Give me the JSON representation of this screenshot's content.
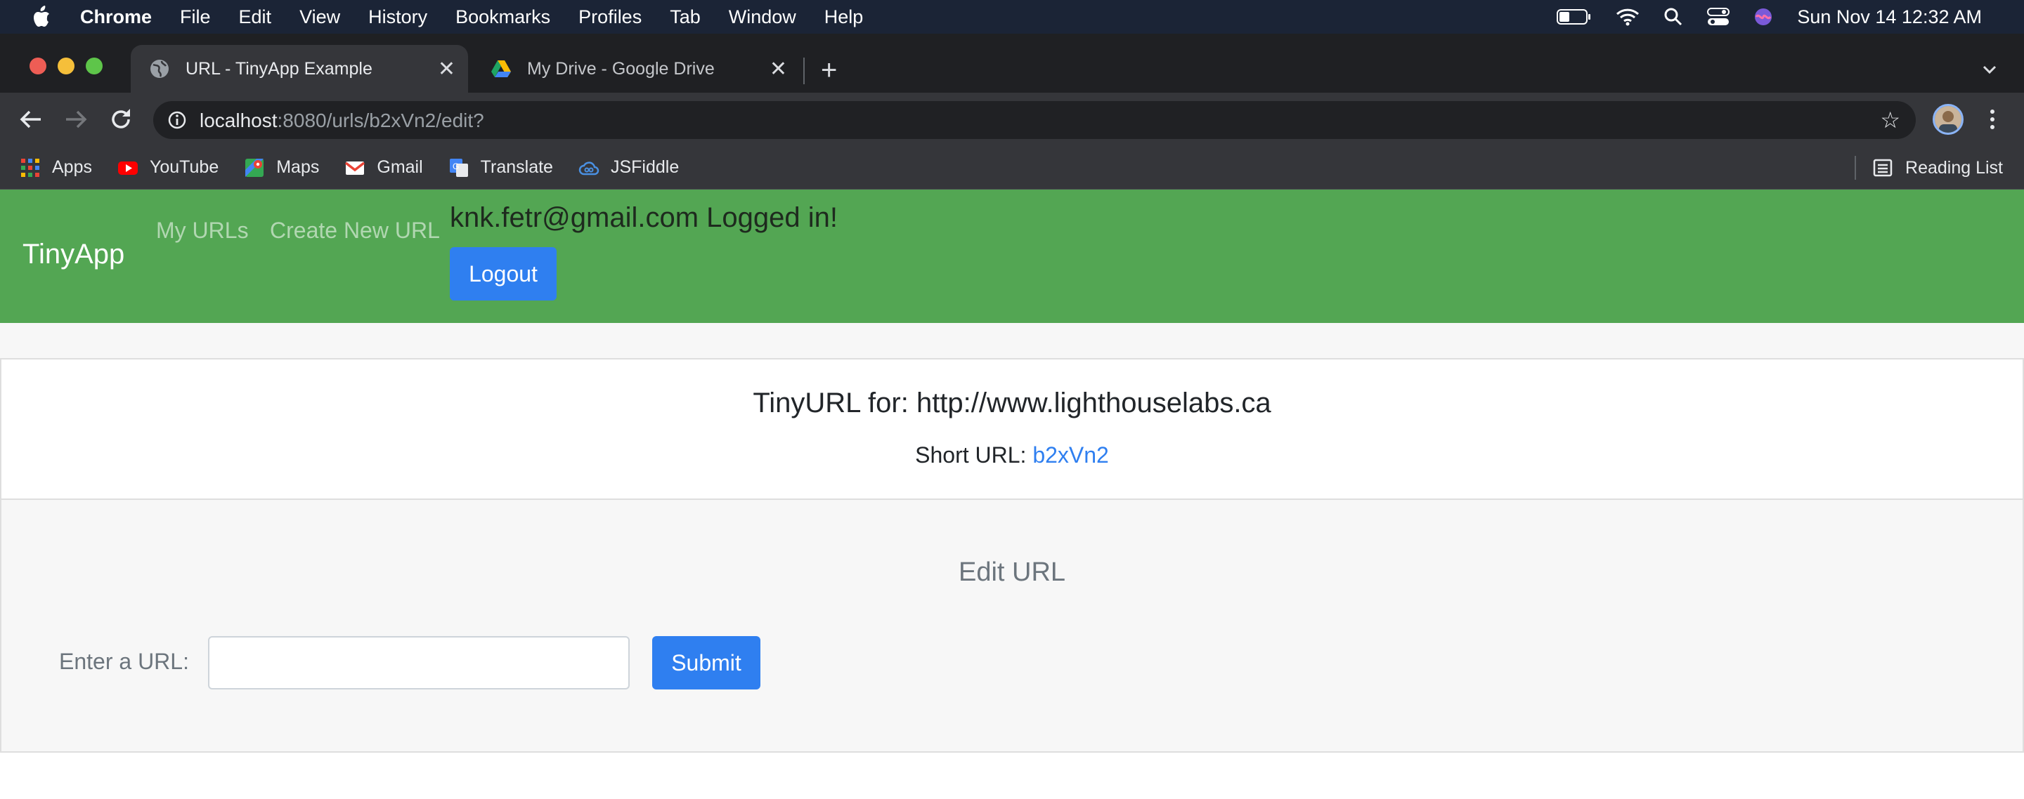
{
  "menubar": {
    "app_name": "Chrome",
    "items": [
      "File",
      "Edit",
      "View",
      "History",
      "Bookmarks",
      "Profiles",
      "Tab",
      "Window",
      "Help"
    ],
    "clock": "Sun Nov 14  12:32 AM"
  },
  "tabs": [
    {
      "title": "URL - TinyApp Example",
      "active": true
    },
    {
      "title": "My Drive - Google Drive",
      "active": false
    }
  ],
  "omnibox": {
    "host": "localhost",
    "path": ":8080/urls/b2xVn2/edit?"
  },
  "bookmarks": {
    "items": [
      "Apps",
      "YouTube",
      "Maps",
      "Gmail",
      "Translate",
      "JSFiddle"
    ],
    "reading_list": "Reading List"
  },
  "page": {
    "brand": "TinyApp",
    "nav_links": [
      "My URLs",
      "Create New URL"
    ],
    "logged_in_text": "knk.fetr@gmail.com Logged in!",
    "logout_label": "Logout",
    "card_title": "TinyURL for: http://www.lighthouselabs.ca",
    "short_url_label": "Short URL: ",
    "short_url_value": "b2xVn2",
    "edit_heading": "Edit URL",
    "url_field_label": "Enter a URL:",
    "url_field_value": "",
    "submit_label": "Submit"
  },
  "colors": {
    "navbar": "#53a653",
    "primary_button": "#2f7ff0",
    "link": "#2f7ff0"
  }
}
